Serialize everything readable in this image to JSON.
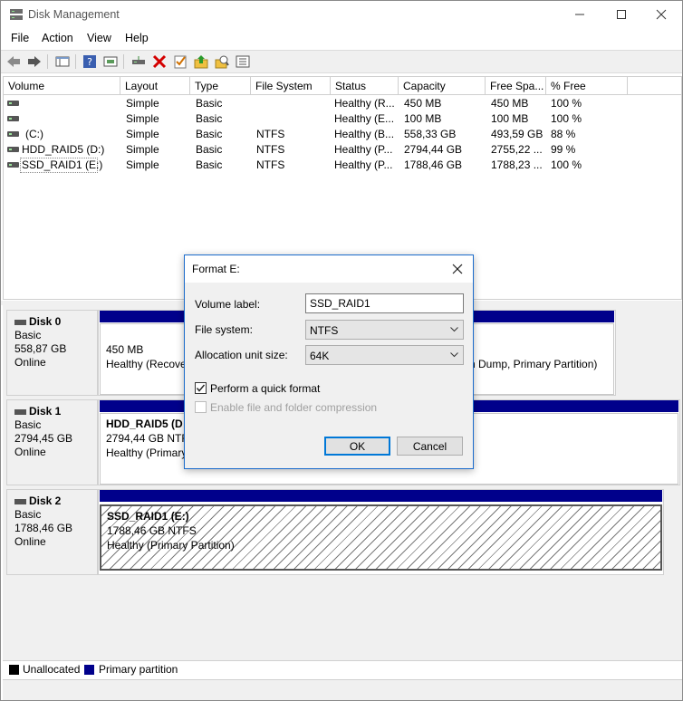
{
  "window": {
    "title": "Disk Management"
  },
  "menu": [
    "File",
    "Action",
    "View",
    "Help"
  ],
  "toolbar": {
    "icons": [
      "back-icon",
      "forward-icon",
      "show-hide-console-tree-icon",
      "help-icon",
      "properties-icon",
      "connect-disk-icon",
      "delete-icon",
      "check-icon",
      "import-icon",
      "rescan-icon",
      "settings-icon"
    ]
  },
  "volume_list": {
    "columns": [
      "Volume",
      "Layout",
      "Type",
      "File System",
      "Status",
      "Capacity",
      "Free Spa...",
      "% Free"
    ],
    "rows": [
      [
        "",
        "Simple",
        "Basic",
        "",
        "Healthy (R...",
        "450 MB",
        "450 MB",
        "100 %"
      ],
      [
        "",
        "Simple",
        "Basic",
        "",
        "Healthy (E...",
        "100 MB",
        "100 MB",
        "100 %"
      ],
      [
        "(C:)",
        "Simple",
        "Basic",
        "NTFS",
        "Healthy (B...",
        "558,33 GB",
        "493,59 GB",
        "88 %"
      ],
      [
        "HDD_RAID5 (D:)",
        "Simple",
        "Basic",
        "NTFS",
        "Healthy (P...",
        "2794,44 GB",
        "2755,22 ...",
        "99 %"
      ],
      [
        "SSD_RAID1 (E:)",
        "Simple",
        "Basic",
        "NTFS",
        "Healthy (P...",
        "1788,46 GB",
        "1788,23 ...",
        "100 %"
      ]
    ]
  },
  "disks": [
    {
      "name": "Disk 0",
      "type": "Basic",
      "size": "558,87 GB",
      "state": "Online",
      "partitions": [
        {
          "line1": "450 MB",
          "line2": "Healthy (Recove"
        },
        {
          "line1": "",
          "line2": "sh Dump, Primary Partition)"
        }
      ]
    },
    {
      "name": "Disk 1",
      "type": "Basic",
      "size": "2794,45 GB",
      "state": "Online",
      "partitions": [
        {
          "title": "HDD_RAID5  (D",
          "line1": "2794,44 GB NTFS",
          "line2": "Healthy (Primary"
        }
      ]
    },
    {
      "name": "Disk 2",
      "type": "Basic",
      "size": "1788,46 GB",
      "state": "Online",
      "partitions": [
        {
          "title": "SSD_RAID1  (E:)",
          "line1": "1788,46 GB NTFS",
          "line2": "Healthy (Primary Partition)"
        }
      ]
    }
  ],
  "legend": {
    "unallocated": "Unallocated",
    "primary": "Primary partition",
    "unallocated_color": "#000000",
    "primary_color": "#00008b"
  },
  "dialog": {
    "title": "Format E:",
    "volume_label_label": "Volume label:",
    "volume_label_value": "SSD_RAID1",
    "file_system_label": "File system:",
    "file_system_value": "NTFS",
    "allocation_label": "Allocation unit size:",
    "allocation_value": "64K",
    "quick_format_label": "Perform a quick format",
    "quick_format_checked": true,
    "compression_label": "Enable file and folder compression",
    "compression_enabled": false,
    "ok_label": "OK",
    "cancel_label": "Cancel"
  }
}
